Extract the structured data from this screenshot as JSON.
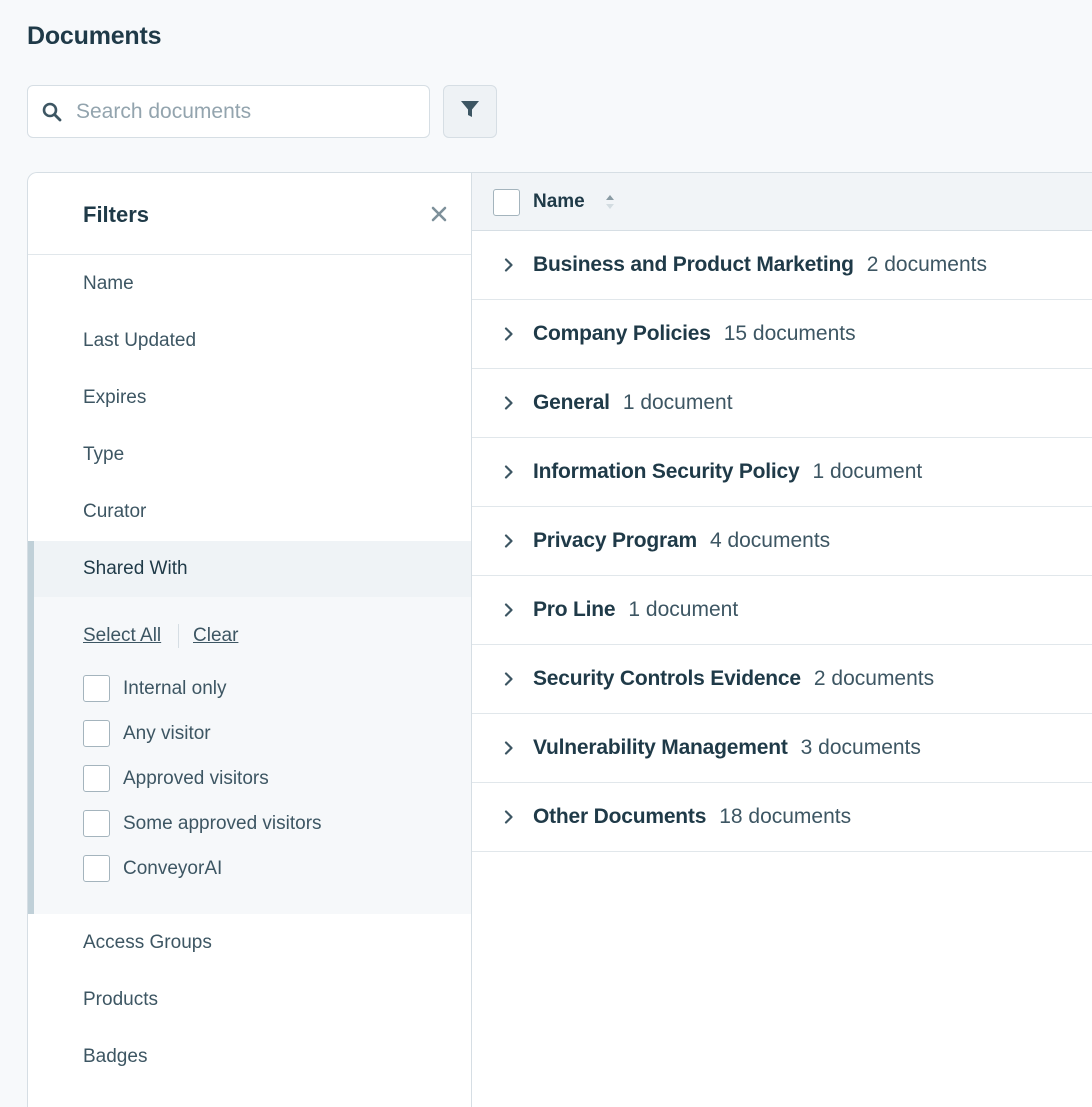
{
  "page": {
    "title": "Documents"
  },
  "search": {
    "placeholder": "Search documents"
  },
  "filters": {
    "title": "Filters",
    "items_top": [
      "Name",
      "Last Updated",
      "Expires",
      "Type",
      "Curator"
    ],
    "shared_with": {
      "title": "Shared With",
      "select_all": "Select All",
      "clear": "Clear",
      "options": [
        "Internal only",
        "Any visitor",
        "Approved visitors",
        "Some approved visitors",
        "ConveyorAI"
      ]
    },
    "items_bottom": [
      "Access Groups",
      "Products",
      "Badges"
    ]
  },
  "table": {
    "name_header": "Name",
    "rows": [
      {
        "name": "Business and Product Marketing",
        "count": "2 documents"
      },
      {
        "name": "Company Policies",
        "count": "15 documents"
      },
      {
        "name": "General",
        "count": "1 document"
      },
      {
        "name": "Information Security Policy",
        "count": "1 document"
      },
      {
        "name": "Privacy Program",
        "count": "4 documents"
      },
      {
        "name": "Pro Line",
        "count": "1 document"
      },
      {
        "name": "Security Controls Evidence",
        "count": "2 documents"
      },
      {
        "name": "Vulnerability Management",
        "count": "3 documents"
      },
      {
        "name": "Other Documents",
        "count": "18 documents"
      }
    ]
  },
  "icons": {
    "search": "search-icon",
    "filter": "funnel-icon",
    "close": "close-icon",
    "sort": "sort-icon",
    "expand": "chevron-right-icon"
  },
  "colors": {
    "text_primary": "#1f3a48",
    "text_secondary": "#3d5663",
    "border": "#d6dee4",
    "active_bar": "#c0d0d8"
  }
}
